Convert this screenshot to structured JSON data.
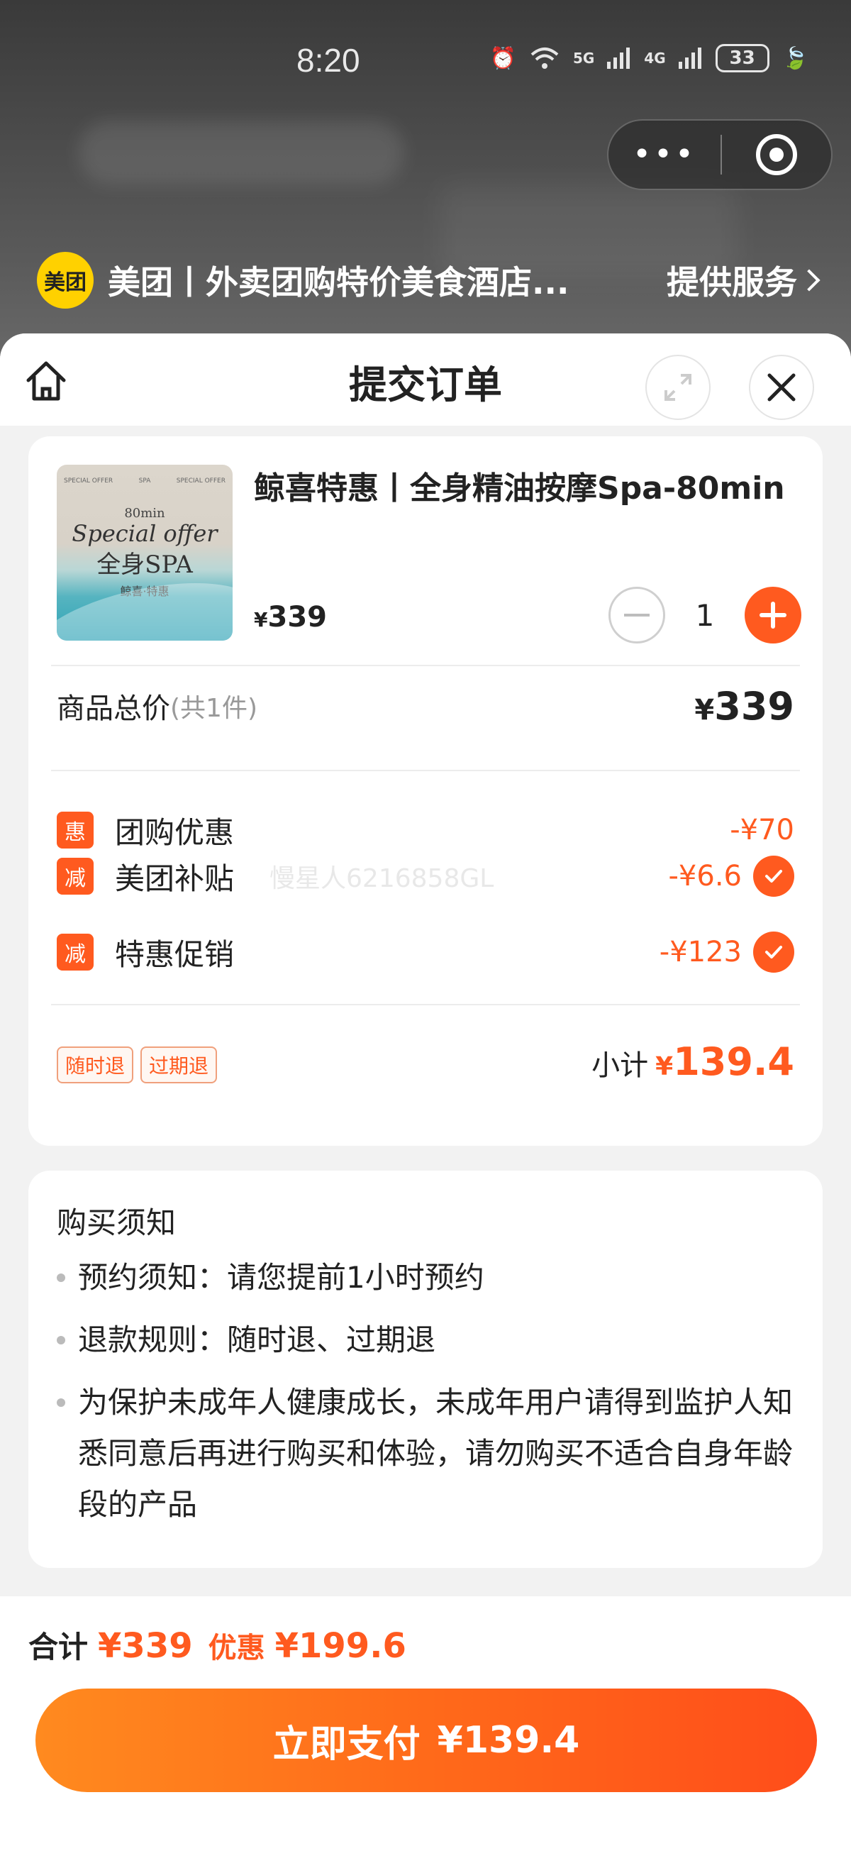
{
  "status": {
    "time": "8:20",
    "net1": "5G",
    "net2": "4G",
    "battery": "33"
  },
  "provider": {
    "logo": "美团",
    "name": "美团丨外卖团购特价美食酒店...",
    "link": "提供服务"
  },
  "sheet": {
    "title": "提交订单"
  },
  "product": {
    "title": "鲸喜特惠丨全身精油按摩Spa-80min",
    "price_symbol": "¥",
    "price": "339",
    "quantity": "1",
    "thumb": {
      "top_left": "SPECIAL OFFER",
      "top_mid": "SPA",
      "top_right": "SPECIAL OFFER",
      "duration": "80min",
      "headline": "Special offer",
      "main": "全身SPA",
      "sub": "鲸喜·特惠"
    }
  },
  "total": {
    "label": "商品总价",
    "count": "(共1件)",
    "symbol": "¥",
    "value": "339"
  },
  "discounts": [
    {
      "tag": "惠",
      "label": "团购优惠",
      "value": "-¥70",
      "checked": false
    },
    {
      "tag": "减",
      "label": "美团补贴",
      "value": "-¥6.6",
      "checked": true,
      "watermark": "慢星人6216858GL"
    },
    {
      "tag": "减",
      "label": "特惠促销",
      "value": "-¥123",
      "checked": true
    }
  ],
  "policy_tags": [
    "随时退",
    "过期退"
  ],
  "subtotal": {
    "label": "小计",
    "symbol": "¥",
    "value": "139.4"
  },
  "notice": {
    "title": "购买须知",
    "items": [
      "预约须知：请您提前1小时预约",
      "退款规则：随时退、过期退",
      "为保护未成年人健康成长，未成年用户请得到监护人知悉同意后再进行购买和体验，请勿购买不适合自身年龄段的产品"
    ]
  },
  "footer": {
    "sum_label": "合计",
    "sum_value": "¥339",
    "disc_label": "优惠",
    "disc_value": "¥199.6",
    "pay_label": "立即支付",
    "pay_amount": "¥139.4"
  },
  "colors": {
    "accent": "#ff5a1f",
    "logo_yellow": "#ffd100"
  }
}
